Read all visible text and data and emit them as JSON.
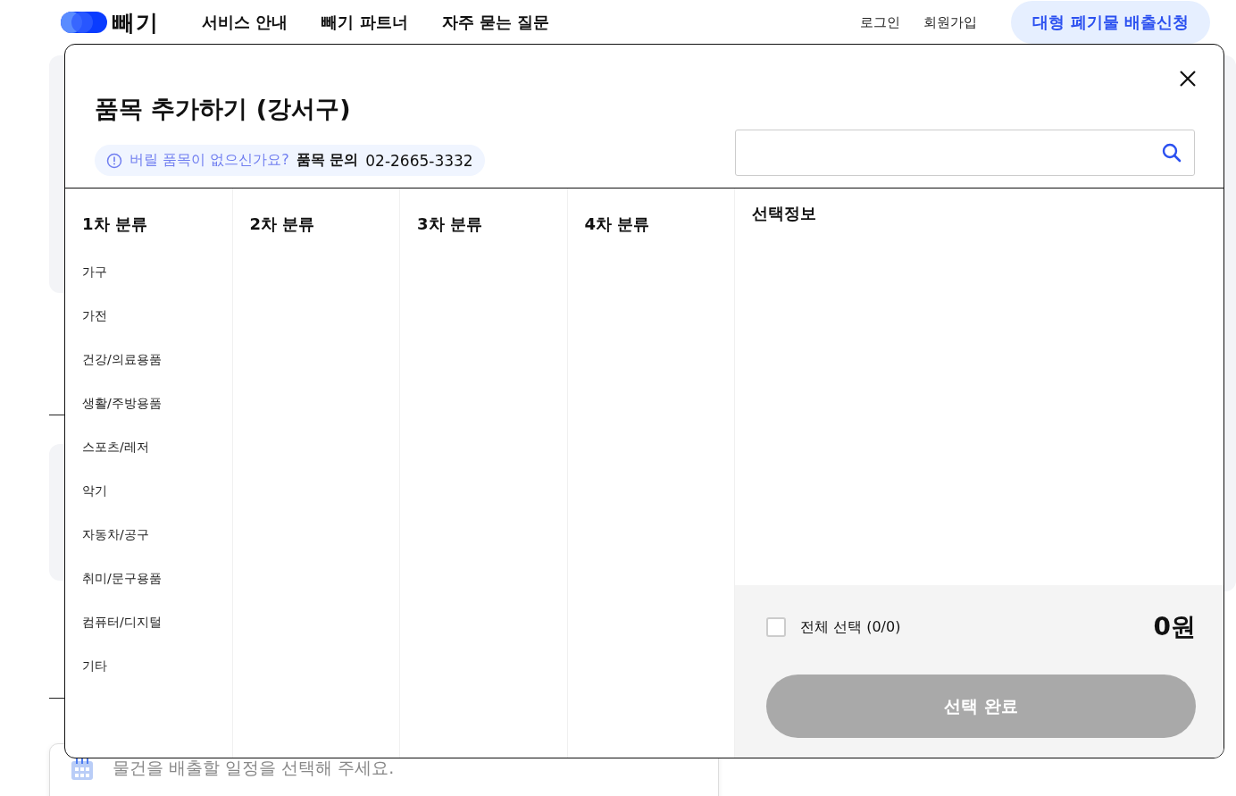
{
  "header": {
    "logo": "빼기",
    "nav": [
      "서비스 안내",
      "빼기 파트너",
      "자주 묻는 질문"
    ],
    "links": [
      "로그인",
      "회원가입"
    ],
    "cta": "대형 폐기물 배출신청"
  },
  "background": {
    "date_field": {
      "placeholder": "물건을 배출할 일정을 선택해 주세요."
    }
  },
  "modal": {
    "title": "품목 추가하기 (강서구)",
    "notice": {
      "question": "버릴 품목이 없으신가요?",
      "label": "품목 문의",
      "phone": "02-2665-3332"
    },
    "columns": [
      {
        "heading": "1차 분류",
        "items": [
          "가구",
          "가전",
          "건강/의료용품",
          "생활/주방용품",
          "스포츠/레저",
          "악기",
          "자동차/공구",
          "취미/문구용품",
          "컴퓨터/디지털",
          "기타"
        ]
      },
      {
        "heading": "2차 분류"
      },
      {
        "heading": "3차 분류"
      },
      {
        "heading": "4차 분류"
      }
    ],
    "selection": {
      "heading": "선택정보",
      "select_all": {
        "label": "전체 선택 (0/0)",
        "checked": false
      },
      "total": "0원",
      "confirm": {
        "label": "선택 완료",
        "disabled": true
      }
    }
  }
}
